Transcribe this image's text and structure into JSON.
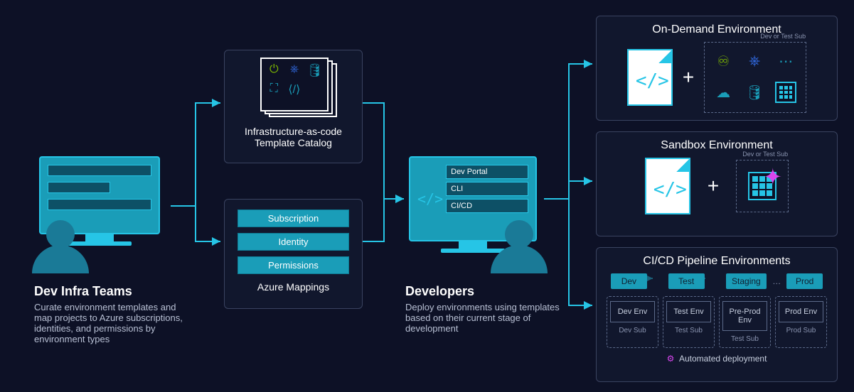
{
  "left": {
    "title": "Dev Infra Teams",
    "desc": "Curate environment templates and map projects to Azure subscriptions, identities, and permissions by environment types"
  },
  "catalog": {
    "title": "Infrastructure-as-code\nTemplate Catalog"
  },
  "mappings": {
    "title": "Azure Mappings",
    "items": [
      "Subscription",
      "Identity",
      "Permissions"
    ]
  },
  "devs": {
    "title": "Developers",
    "desc": "Deploy environments using templates based on their current stage of development",
    "tools": [
      "Dev Portal",
      "CLI",
      "CI/CD"
    ]
  },
  "ondemand": {
    "title": "On-Demand Environment",
    "subNote": "Dev or Test Sub"
  },
  "sandbox": {
    "title": "Sandbox Environment",
    "subNote": "Dev or Test Sub"
  },
  "pipeline": {
    "title": "CI/CD Pipeline Environments",
    "stages": [
      "Dev",
      "Test",
      "Staging",
      "Prod"
    ],
    "ellipsis": "…",
    "envs": [
      {
        "name": "Dev Env",
        "sub": "Dev Sub"
      },
      {
        "name": "Test Env",
        "sub": "Test Sub"
      },
      {
        "name": "Pre-Prod Env",
        "sub": "Test Sub"
      },
      {
        "name": "Prod Env",
        "sub": "Prod Sub"
      }
    ],
    "auto": "Automated deployment"
  }
}
